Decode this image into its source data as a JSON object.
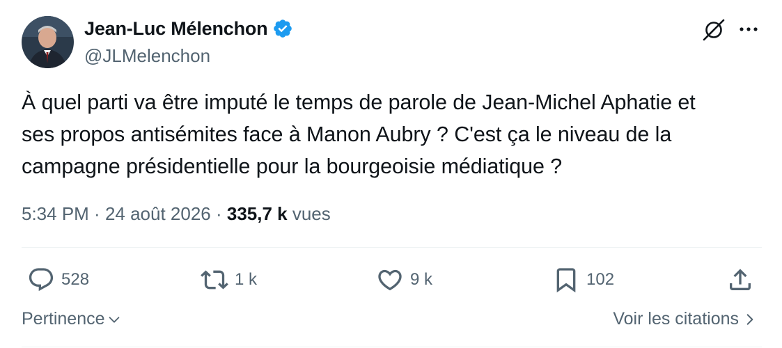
{
  "author": {
    "display_name": "Jean-Luc Mélenchon",
    "handle": "@JLMelenchon",
    "verified": true
  },
  "tweet": {
    "text": "À quel parti va être imputé le temps de parole de Jean-Michel Aphatie et\nses propos antisémites face à Manon Aubry ? C'est ça le niveau de la\ncampagne présidentielle pour la bourgeoisie médiatique ?",
    "time": "5:34 PM",
    "sep1": " · ",
    "date": "24 août 2026",
    "sep2": " · ",
    "views_count": "335,7 k",
    "views_label": " vues"
  },
  "actions": {
    "replies": "528",
    "reposts": "1 k",
    "likes": "9 k",
    "bookmarks": "102"
  },
  "footer": {
    "sort_label": "Pertinence",
    "quotes_label": "Voir les citations"
  },
  "icons": {
    "verified": "verified-badge-icon",
    "grok": "grok-icon",
    "more": "more-icon",
    "reply": "reply-icon",
    "repost": "repost-icon",
    "like": "heart-icon",
    "bookmark": "bookmark-icon",
    "share": "share-icon"
  },
  "colors": {
    "text_primary": "#0f1419",
    "text_secondary": "#536471",
    "verified_blue": "#1d9bf0",
    "divider": "#eff3f4"
  }
}
